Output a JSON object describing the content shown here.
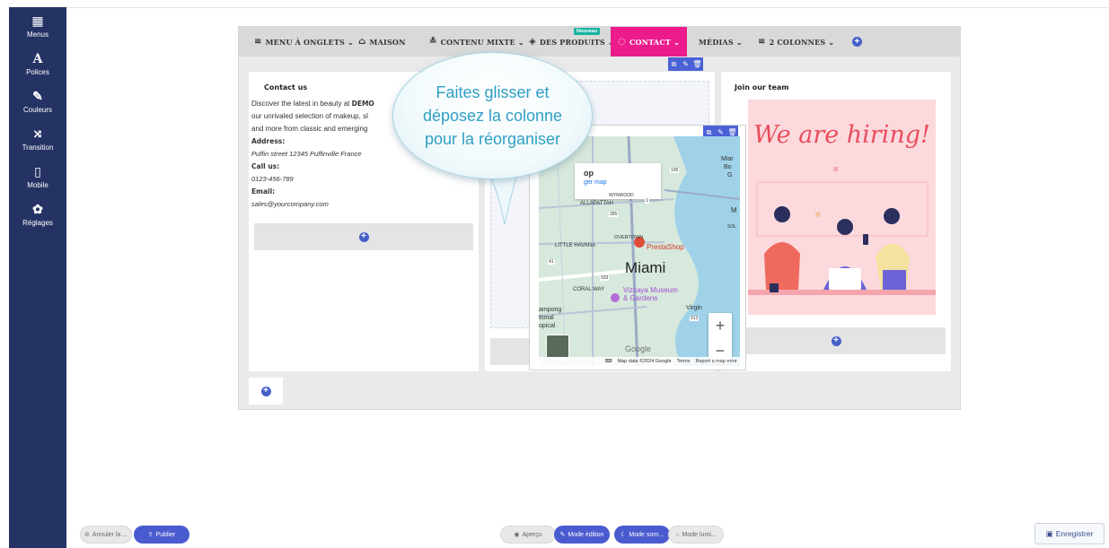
{
  "sidebar": {
    "items": [
      {
        "label": "Menus",
        "icon": "grid-icon",
        "glyph": "▦"
      },
      {
        "label": "Polices",
        "icon": "font-icon",
        "glyph": "A"
      },
      {
        "label": "Couleurs",
        "icon": "brush-icon",
        "glyph": "✎"
      },
      {
        "label": "Transition",
        "icon": "shuffle-icon",
        "glyph": "⤨"
      },
      {
        "label": "Mobile",
        "icon": "mobile-icon",
        "glyph": "▯"
      },
      {
        "label": "Réglages",
        "icon": "gear-icon",
        "glyph": "✿"
      }
    ]
  },
  "menu": {
    "items": [
      {
        "label": "MENU À ONGLETS",
        "icon": "≡",
        "chevron": "⌄"
      },
      {
        "label": "MAISON",
        "icon": "⌂",
        "chevron": ""
      },
      {
        "label": "CONTENU MIXTE",
        "icon": "≛",
        "chevron": "⌄"
      },
      {
        "label": "DES PRODUITS",
        "icon": "◈",
        "chevron": "⌄"
      },
      {
        "label": "CONTACT",
        "icon": "◌",
        "chevron": "⌄"
      },
      {
        "label": "MÉDIAS",
        "icon": "",
        "chevron": "⌄"
      },
      {
        "label": "2 COLONNES",
        "icon": "≡",
        "chevron": "⌄"
      }
    ],
    "new_badge": "Nouveau",
    "active_color": "#ec1c8c"
  },
  "contact_col": {
    "title": "Contact us",
    "line1_pre": "Discover the latest in beauty at ",
    "line1_bold": "DEMO",
    "line2": "our unrivaled selection of makeup, sl",
    "line3": "and more from classic and emerging",
    "address_label": "Address:",
    "address": "Puffin street 12345 Puffinville France",
    "call_label": "Call us:",
    "phone": "0123-456-789",
    "email_label": "Email:",
    "email": "sales@yourcompany.com"
  },
  "bubble": {
    "line1": "Faites glisser et",
    "line2": "déposez la colonne",
    "line3": "pour la réorganiser"
  },
  "map": {
    "card_title": "op",
    "card_link": "ger map",
    "city": "Miami",
    "pin_label": "PrestaShop",
    "poi": "Vizcaya Museum",
    "poi2": "& Gardens",
    "area1": "LITTLE HAVANA",
    "area2": "CORAL WAY",
    "area3": "ALLAPATTAH",
    "area4": "WYNWOOD",
    "area5": "OVERTOWN",
    "area6": "Virgin",
    "left1": "ampong",
    "left2": "tional",
    "left3": "opical",
    "right1": "Miar",
    "right2": "Bo",
    "right3": "G",
    "right4": "M",
    "right5": "SOL",
    "shield1": "195",
    "shield2": "395",
    "shield3": "933",
    "shield4": "41",
    "shield5": "1",
    "shield6": "913",
    "google": "Google",
    "footer_data": "Map data ©2024 Google",
    "footer_terms": "Terms",
    "footer_report": "Report a map error",
    "zoom_in": "+",
    "zoom_out": "−"
  },
  "team_col": {
    "title": "Join our team",
    "hiring_text": "We are hiring!"
  },
  "bottombar": {
    "cancel": "Annuler la ...",
    "publish": "Publier",
    "preview": "Aperçu",
    "edit_mode": "Mode édition",
    "dark_mode": "Mode som...",
    "light_mode": "Mode lumi...",
    "save": "Enregistrer"
  }
}
